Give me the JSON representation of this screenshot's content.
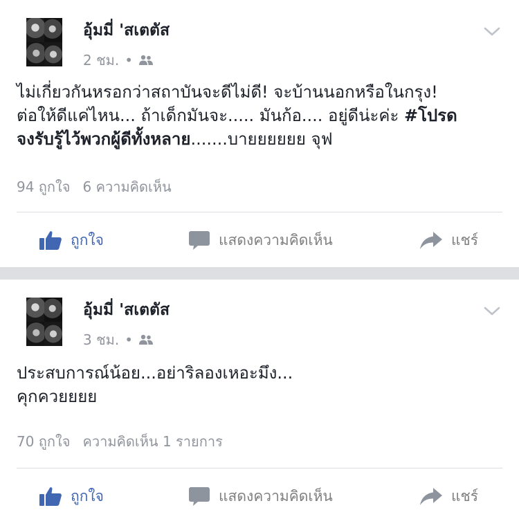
{
  "posts": [
    {
      "author": "อุ้มมี่ 'สเตตัส",
      "time": "2 ชม.",
      "dot": "•",
      "lines": [
        "ไม่เกี่ยวกันหรอกว่าสถาบันจะดีไม่ดี! จะบ้านนอกหรือในกรุง!",
        "ต่อให้ดีแค่ไหน... ถ้าเด็กมันจะ..... มันก้อ.... อยู่ดีน่ะค่ะ "
      ],
      "hashtag_part1": "#โปรด",
      "hashtag_part2": "จงรับรู้ไว้พวกผู้ดีทั้งหลาย",
      "tail": ".......บายยยยยย จุฟ",
      "likes": "94 ถูกใจ",
      "comments": "6 ความคิดเห็น"
    },
    {
      "author": "อุ้มมี่ 'สเตตัส",
      "time": "3 ชม.",
      "dot": "•",
      "lines": [
        "ประสบการณ์น้อย...อย่าริลองเหอะมึง...",
        "คุกควยยยย"
      ],
      "likes": "70 ถูกใจ",
      "comments": "ความคิดเห็น 1 รายการ"
    }
  ],
  "actions": {
    "like": "ถูกใจ",
    "comment": "แสดงความคิดเห็น",
    "share": "แชร์"
  },
  "icons": {
    "like": "thumbs-up-icon",
    "comment": "speech-bubble-icon",
    "share": "share-arrow-icon",
    "audience": "friends-icon",
    "menu": "chevron-down-icon"
  },
  "colors": {
    "like_blue": "#4267b2",
    "meta_gray": "#90949c",
    "separator": "#dddfe2"
  }
}
